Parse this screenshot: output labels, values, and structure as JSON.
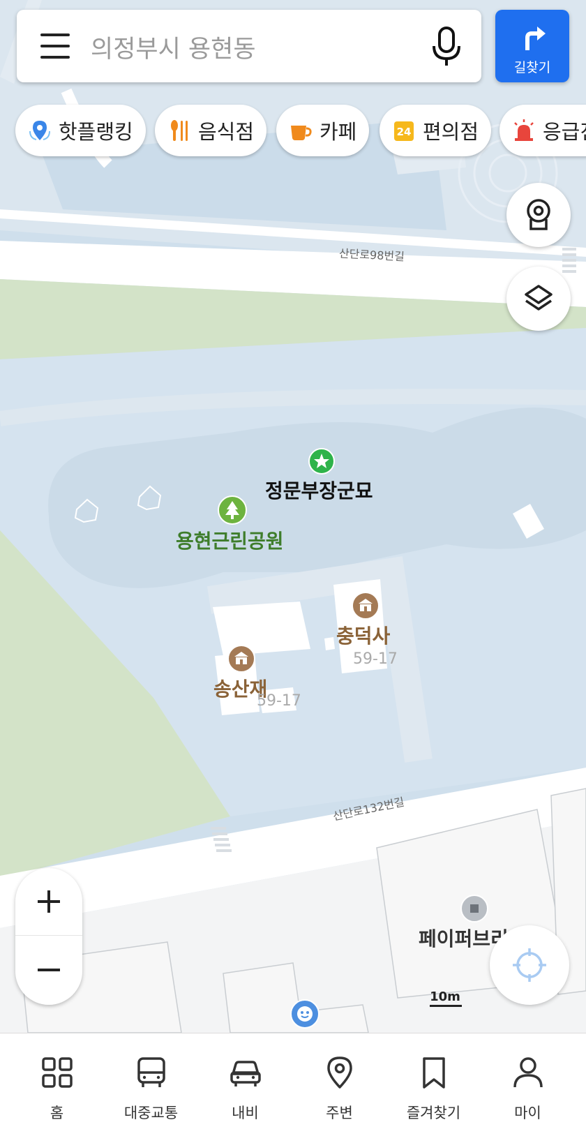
{
  "search": {
    "placeholder": "의정부시 용현동"
  },
  "route_button": {
    "label": "길찾기"
  },
  "categories": [
    {
      "label": "핫플랭킹",
      "icon": "hot-place-icon"
    },
    {
      "label": "음식점",
      "icon": "restaurant-icon"
    },
    {
      "label": "카페",
      "icon": "cafe-icon"
    },
    {
      "label": "편의점",
      "icon": "convenience-store-icon"
    },
    {
      "label": "응급진",
      "icon": "emergency-icon"
    }
  ],
  "map": {
    "roads": [
      "산단로98번길",
      "산단로132번길"
    ],
    "pois": {
      "memorial": "정문부장군묘",
      "park": "용현근린공원",
      "shrine": "충덕사",
      "shrine_number": "59-17",
      "hall": "송산재",
      "hall_number": "59-17",
      "building": "페이퍼브리"
    },
    "scale_label": "10m"
  },
  "bottom_nav": [
    {
      "label": "홈",
      "icon": "home-grid-icon"
    },
    {
      "label": "대중교통",
      "icon": "bus-icon"
    },
    {
      "label": "내비",
      "icon": "car-icon"
    },
    {
      "label": "주변",
      "icon": "location-pin-icon"
    },
    {
      "label": "즐겨찾기",
      "icon": "bookmark-icon"
    },
    {
      "label": "마이",
      "icon": "person-icon"
    }
  ],
  "colors": {
    "accent": "#1f6fef",
    "water": "#d7e4ef",
    "park": "#d4e4c9",
    "road": "#ffffff"
  }
}
